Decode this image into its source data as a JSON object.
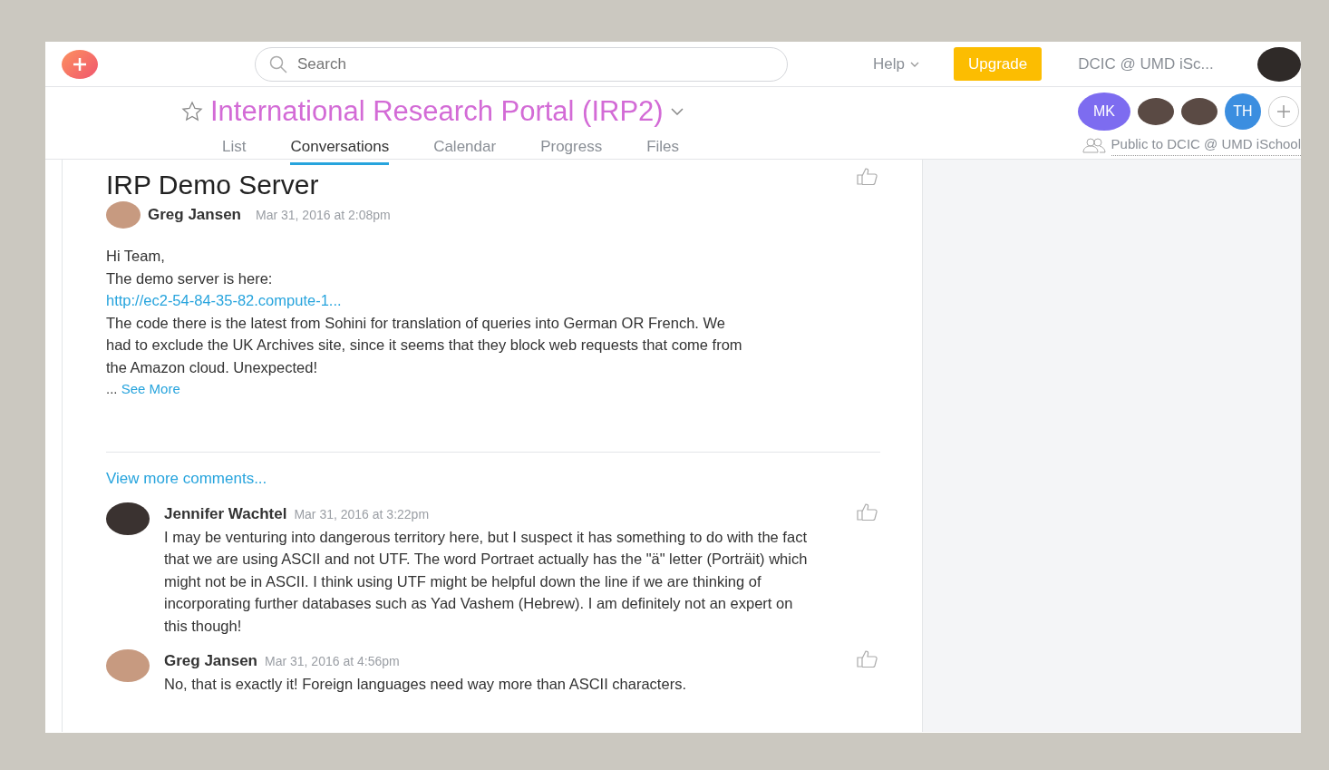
{
  "topbar": {
    "search": {
      "placeholder": "Search"
    },
    "help": "Help",
    "upgrade": "Upgrade",
    "workspace": "DCIC @ UMD iSc..."
  },
  "project": {
    "title": "International Research Portal (IRP2)",
    "starred": false,
    "tabs": [
      {
        "label": "List",
        "selected": false
      },
      {
        "label": "Conversations",
        "selected": true
      },
      {
        "label": "Calendar",
        "selected": false
      },
      {
        "label": "Progress",
        "selected": false
      },
      {
        "label": "Files",
        "selected": false
      }
    ],
    "members": [
      {
        "kind": "initials",
        "initials": "MK",
        "color": "#7d6cf0"
      },
      {
        "kind": "photo"
      },
      {
        "kind": "photo"
      },
      {
        "kind": "initials",
        "initials": "TH",
        "color": "#3b8ee0"
      }
    ],
    "visibility": "Public to DCIC @ UMD iSchool"
  },
  "conversation": {
    "title": "IRP Demo Server",
    "author": "Greg Jansen",
    "date": "Mar 31, 2016 at 2:08pm",
    "body": [
      {
        "kind": "text",
        "text": "Hi Team,"
      },
      {
        "kind": "text",
        "text": "The demo server is here:"
      },
      {
        "kind": "link",
        "text": "http://ec2-54-84-35-82.compute-1..."
      },
      {
        "kind": "text",
        "text": "The code there is the latest from Sohini for translation of queries into German OR French. We had to exclude the UK Archives site, since it seems that they block web requests that come from the Amazon cloud. Unexpected!"
      }
    ],
    "ellipsis": "...",
    "see_more": "See More",
    "view_more": "View more comments...",
    "comments": [
      {
        "author": "Jennifer Wachtel",
        "date": "Mar 31, 2016 at 3:22pm",
        "text": "I may be venturing into dangerous territory here, but I suspect it has something to do with the fact that we are using ASCII and not UTF. The word Portraet actually has the \"ä\"  letter (Porträit) which might not be in ASCII. I think using UTF might be helpful down the line if we are thinking of incorporating further databases such as Yad Vashem (Hebrew). I am definitely not an expert on this though!"
      },
      {
        "author": "Greg Jansen",
        "date": "Mar 31, 2016 at 4:56pm",
        "text": "No, that is exactly it! Foreign languages need way more than ASCII characters."
      }
    ]
  }
}
